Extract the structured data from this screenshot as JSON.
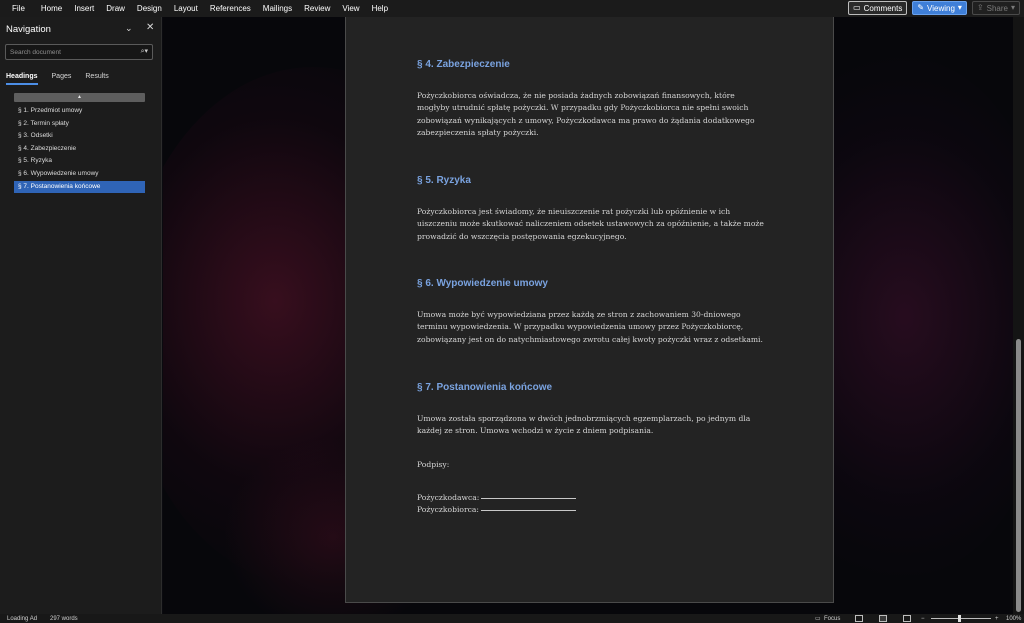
{
  "menu": [
    "File",
    "Home",
    "Insert",
    "Draw",
    "Design",
    "Layout",
    "References",
    "Mailings",
    "Review",
    "View",
    "Help"
  ],
  "toolbar": {
    "comments_label": "Comments",
    "viewing_label": "Viewing",
    "share_label": "Share"
  },
  "nav": {
    "title": "Navigation",
    "search_placeholder": "Search document",
    "tabs": [
      "Headings",
      "Pages",
      "Results"
    ],
    "collapse_glyph": "▲",
    "items": [
      "§ 1. Przedmiot umowy",
      "§ 2. Termin spłaty",
      "§ 3. Odsetki",
      "§ 4. Zabezpieczenie",
      "§ 5. Ryzyka",
      "§ 6. Wypowiedzenie umowy",
      "§ 7. Postanowienia końcowe"
    ],
    "active_index": 6
  },
  "document": {
    "s4_heading": "§ 4. Zabezpieczenie",
    "s4_text": "Pożyczkobiorca oświadcza, że nie posiada żadnych zobowiązań finansowych, które mogłyby utrudnić spłatę pożyczki. W przypadku gdy Pożyczkobiorca nie spełni swoich zobowiązań wynikających z umowy, Pożyczkodawca ma prawo do żądania dodatkowego zabezpieczenia spłaty pożyczki.",
    "s5_heading": "§ 5. Ryzyka",
    "s5_text": "Pożyczkobiorca jest świadomy, że nieuiszczenie rat pożyczki lub opóźnienie w ich uiszczeniu może skutkować naliczeniem odsetek ustawowych za opóźnienie, a także może prowadzić do wszczęcia postępowania egzekucyjnego.",
    "s6_heading": "§ 6. Wypowiedzenie umowy",
    "s6_text": "Umowa może być wypowiedziana przez każdą ze stron z zachowaniem 30-dniowego terminu wypowiedzenia. W przypadku wypowiedzenia umowy przez Pożyczkobiorcę, zobowiązany jest on do natychmiastowego zwrotu całej kwoty pożyczki wraz z odsetkami.",
    "s7_heading": "§ 7. Postanowienia końcowe",
    "s7_text": "Umowa została sporządzona w dwóch jednobrzmiących egzemplarzach, po jednym dla każdej ze stron. Umowa wchodzi w życie z dniem podpisania.",
    "signatures_label": "Podpisy:",
    "lender_label": "Pożyczkodawca:",
    "borrower_label": "Pożyczkobiorca:"
  },
  "status": {
    "loading": "Loading Ad",
    "words": "297 words",
    "focus": "Focus",
    "zoom": "100%"
  },
  "colors": {
    "accent": "#3f7fd8",
    "heading": "#7aa3e0",
    "nav_active": "#2f64b6"
  }
}
